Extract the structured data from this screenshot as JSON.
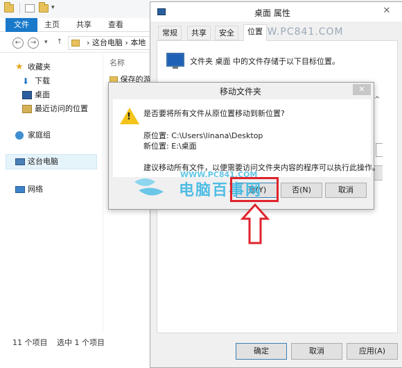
{
  "explorer": {
    "ribbon_tabs": [
      "文件",
      "主页",
      "共享",
      "查看"
    ],
    "address_segments": [
      "这台电脑",
      "本地"
    ],
    "nav": {
      "favorites": "收藏夹",
      "downloads": "下载",
      "desktop": "桌面",
      "recent": "最近访问的位置",
      "homegroup": "家庭组",
      "this_pc": "这台电脑",
      "network": "网络"
    },
    "column_header": "名称",
    "file_partial": "保存的游",
    "status_count": "11 个项目",
    "status_selected": "选中 1 个项目"
  },
  "properties": {
    "title": "桌面 属性",
    "tabs": [
      "常规",
      "共享",
      "安全",
      "位置"
    ],
    "active_tab": "位置",
    "description": "文件夹 桌面 中的文件存储于以下目标位置。",
    "buttons": {
      "ok": "确定",
      "cancel": "取消",
      "apply": "应用(A)"
    }
  },
  "move_dialog": {
    "title": "移动文件夹",
    "question": "是否要将所有文件从原位置移动到新位置?",
    "old_location": "原位置: C:\\Users\\linana\\Desktop",
    "new_location": "新位置: E:\\桌面",
    "advice": "建议移动所有文件，以便需要访问文件夹内容的程序可以执行此操作。",
    "buttons": {
      "yes": "是(Y)",
      "no": "否(N)",
      "cancel": "取消"
    }
  },
  "watermark": {
    "url_top": "WWW.PC841.COM",
    "url_mid": "WWW.PC841.COM",
    "brand": "电脑百事网"
  },
  "colors": {
    "file_tab": "#1979ca",
    "highlight": "#e0232c",
    "warning": "#f4c41a"
  }
}
